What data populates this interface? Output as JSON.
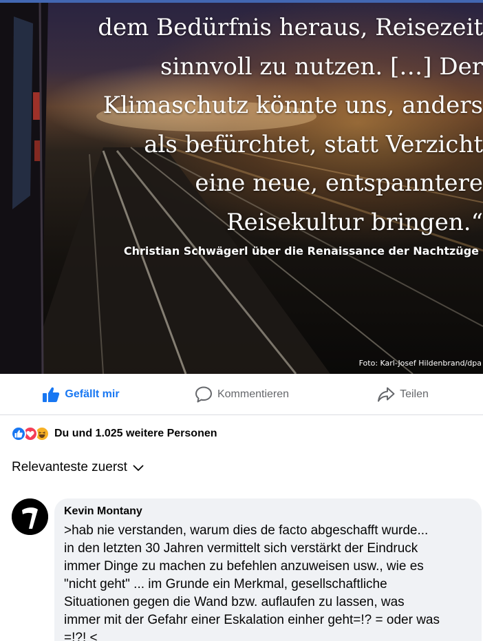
{
  "post_image": {
    "quote_lines": [
      "dem Bedürfnis heraus, Reisezeit",
      "sinnvoll zu nutzen. […] Der",
      "Klimaschutz könnte uns, anders",
      "als befürchtet, statt Verzicht",
      "eine neue, entspanntere",
      "Reisekultur bringen.“"
    ],
    "attribution": "Christian Schwägerl über die Renaissance der Nachtzüge",
    "photo_credit": "Foto: Karl-Josef Hildenbrand/dpa"
  },
  "actions": {
    "like_label": "Gefällt mir",
    "comment_label": "Kommentieren",
    "share_label": "Teilen"
  },
  "reactions": {
    "icons": [
      "like-icon",
      "love-icon",
      "haha-icon"
    ],
    "summary": "Du und 1.025 weitere Personen"
  },
  "sort": {
    "label": "Relevanteste zuerst"
  },
  "comments": [
    {
      "author": "Kevin Montany",
      "text": ">hab nie verstanden, warum dies de facto  abgeschafft wurde...\nin den letzten 30 Jahren vermittelt sich verstärkt der  Eindruck\nimmer Dinge zu machen zu befehlen anzuweisen usw., wie es\n\"nicht geht\" ...  im Grunde ein Merkmal, gesellschaftliche\nSituationen gegen die Wand bzw. auflaufen zu lassen, was\nimmer mit der Gefahr einer Eskalation einher geht=!? = oder was\n=!?! <"
    }
  ],
  "colors": {
    "accent": "#1877f2",
    "secondary_text": "#65676b",
    "bubble": "#f0f2f5",
    "love": "#f33e58",
    "haha": "#f7b125"
  }
}
